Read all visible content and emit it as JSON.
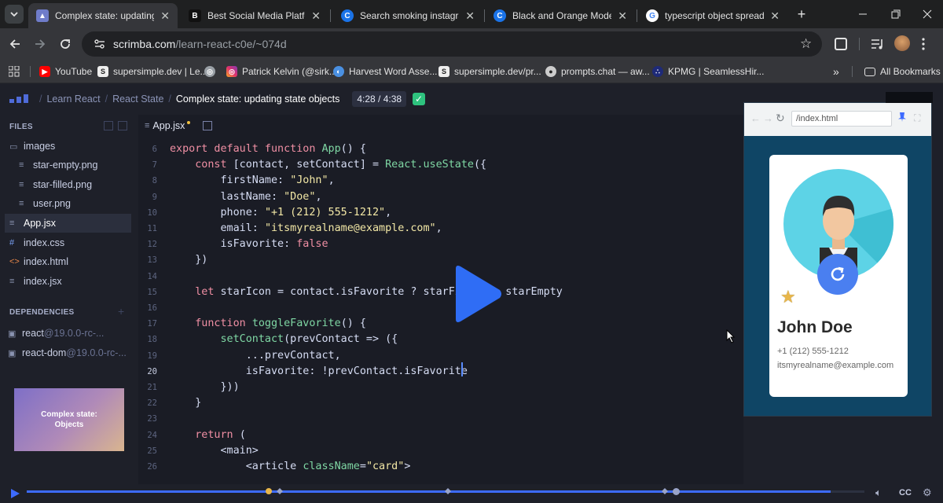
{
  "tabs": [
    {
      "title": "Complex state: updating stat",
      "active": true
    },
    {
      "title": "Best Social Media Platforms",
      "active": false
    },
    {
      "title": "Search smoking instagram c",
      "active": false
    },
    {
      "title": "Black and Orange Modern B",
      "active": false
    },
    {
      "title": "typescript object spread syn",
      "active": false
    }
  ],
  "toolbar": {
    "url_domain": "scrimba.com",
    "url_path": "/learn-react-c0e/~074d"
  },
  "bookmarks": [
    {
      "label": "YouTube",
      "icon": "youtube-icon"
    },
    {
      "label": "supersimple.dev | Le...",
      "icon": "s-icon"
    },
    {
      "label": "",
      "icon": "globe-icon"
    },
    {
      "label": "Patrick Kelvin (@sirk...",
      "icon": "instagram-icon"
    },
    {
      "label": "Harvest Word Asse...",
      "icon": "harvest-icon"
    },
    {
      "label": "supersimple.dev/pr...",
      "icon": "s-icon"
    },
    {
      "label": "prompts.chat — aw...",
      "icon": "github-icon"
    },
    {
      "label": "KPMG | SeamlessHir...",
      "icon": "kpmg-icon"
    }
  ],
  "all_bookmarks": "All Bookmarks",
  "breadcrumb": {
    "course": "Learn React",
    "section": "React State",
    "lesson": "Complex state: updating state objects",
    "time": "4:28 / 4:38"
  },
  "sidebar": {
    "files_heading": "FILES",
    "files": [
      {
        "name": "images",
        "icon": "folder-icon",
        "indent": 0
      },
      {
        "name": "star-empty.png",
        "icon": "image-file-icon",
        "indent": 1
      },
      {
        "name": "star-filled.png",
        "icon": "image-file-icon",
        "indent": 1
      },
      {
        "name": "user.png",
        "icon": "image-file-icon",
        "indent": 1
      },
      {
        "name": "App.jsx",
        "icon": "jsx-file-icon",
        "indent": 0,
        "selected": true
      },
      {
        "name": "index.css",
        "icon": "css-file-icon",
        "indent": 0
      },
      {
        "name": "index.html",
        "icon": "html-file-icon",
        "indent": 0
      },
      {
        "name": "index.jsx",
        "icon": "jsx-file-icon",
        "indent": 0
      }
    ],
    "deps_heading": "DEPENDENCIES",
    "deps": [
      {
        "name": "react",
        "version": "@19.0.0-rc-..."
      },
      {
        "name": "react-dom",
        "version": "@19.0.0-rc-..."
      }
    ],
    "thumbnail_title": "Complex state: Objects"
  },
  "editor": {
    "tab": "App.jsx",
    "current_line": 20,
    "lines": [
      {
        "n": 6,
        "segs": [
          [
            "kw",
            "export default function "
          ],
          [
            "fn",
            "App"
          ],
          [
            "tx",
            "() {"
          ]
        ]
      },
      {
        "n": 7,
        "segs": [
          [
            "tx",
            "    "
          ],
          [
            "kw",
            "const "
          ],
          [
            "tx",
            "[contact, setContact] = "
          ],
          [
            "fn",
            "React.useState"
          ],
          [
            "tx",
            "({"
          ]
        ]
      },
      {
        "n": 8,
        "segs": [
          [
            "tx",
            "        firstName: "
          ],
          [
            "str",
            "\"John\""
          ],
          [
            "tx",
            ","
          ]
        ]
      },
      {
        "n": 9,
        "segs": [
          [
            "tx",
            "        lastName: "
          ],
          [
            "str",
            "\"Doe\""
          ],
          [
            "tx",
            ","
          ]
        ]
      },
      {
        "n": 10,
        "segs": [
          [
            "tx",
            "        phone: "
          ],
          [
            "str",
            "\"+1 (212) 555-1212\""
          ],
          [
            "tx",
            ","
          ]
        ]
      },
      {
        "n": 11,
        "segs": [
          [
            "tx",
            "        email: "
          ],
          [
            "str",
            "\"itsmyrealname@example.com\""
          ],
          [
            "tx",
            ","
          ]
        ]
      },
      {
        "n": 12,
        "segs": [
          [
            "tx",
            "        isFavorite: "
          ],
          [
            "kw",
            "false"
          ]
        ]
      },
      {
        "n": 13,
        "segs": [
          [
            "tx",
            "    })"
          ]
        ]
      },
      {
        "n": 14,
        "segs": [
          [
            "tx",
            ""
          ]
        ]
      },
      {
        "n": 15,
        "segs": [
          [
            "tx",
            "    "
          ],
          [
            "kw",
            "let "
          ],
          [
            "tx",
            "starIcon = contact.isFavorite ? starFi       starEmpty"
          ]
        ]
      },
      {
        "n": 16,
        "segs": [
          [
            "tx",
            ""
          ]
        ]
      },
      {
        "n": 17,
        "segs": [
          [
            "tx",
            "    "
          ],
          [
            "kw",
            "function "
          ],
          [
            "fn",
            "toggleFavorite"
          ],
          [
            "tx",
            "() {"
          ]
        ]
      },
      {
        "n": 18,
        "segs": [
          [
            "tx",
            "        "
          ],
          [
            "fn",
            "setContact"
          ],
          [
            "tx",
            "(prevContact => ({"
          ]
        ]
      },
      {
        "n": 19,
        "segs": [
          [
            "tx",
            "            ...prevContact,"
          ]
        ]
      },
      {
        "n": 20,
        "segs": [
          [
            "tx",
            "            isFavorite: !prevContact.isFavorite"
          ]
        ]
      },
      {
        "n": 21,
        "segs": [
          [
            "tx",
            "        }))"
          ]
        ]
      },
      {
        "n": 22,
        "segs": [
          [
            "tx",
            "    }"
          ]
        ]
      },
      {
        "n": 23,
        "segs": [
          [
            "tx",
            ""
          ]
        ]
      },
      {
        "n": 24,
        "segs": [
          [
            "tx",
            "    "
          ],
          [
            "kw",
            "return "
          ],
          [
            "tx",
            "("
          ]
        ]
      },
      {
        "n": 25,
        "segs": [
          [
            "tx",
            "        <main>"
          ]
        ]
      },
      {
        "n": 26,
        "segs": [
          [
            "tx",
            "            <article "
          ],
          [
            "fn",
            "className"
          ],
          [
            "tx",
            "="
          ],
          [
            "str",
            "\"card\""
          ],
          [
            "tx",
            ">"
          ]
        ]
      }
    ]
  },
  "preview": {
    "url": "/index.html",
    "name": "John Doe",
    "phone": "+1 (212) 555-1212",
    "email": "itsmyrealname@example.com"
  },
  "player": {
    "cc": "CC",
    "progress": 0.96
  },
  "colors": {
    "accent": "#3d6bff",
    "play": "#2f6df5",
    "preview_bg": "#0f4565"
  }
}
